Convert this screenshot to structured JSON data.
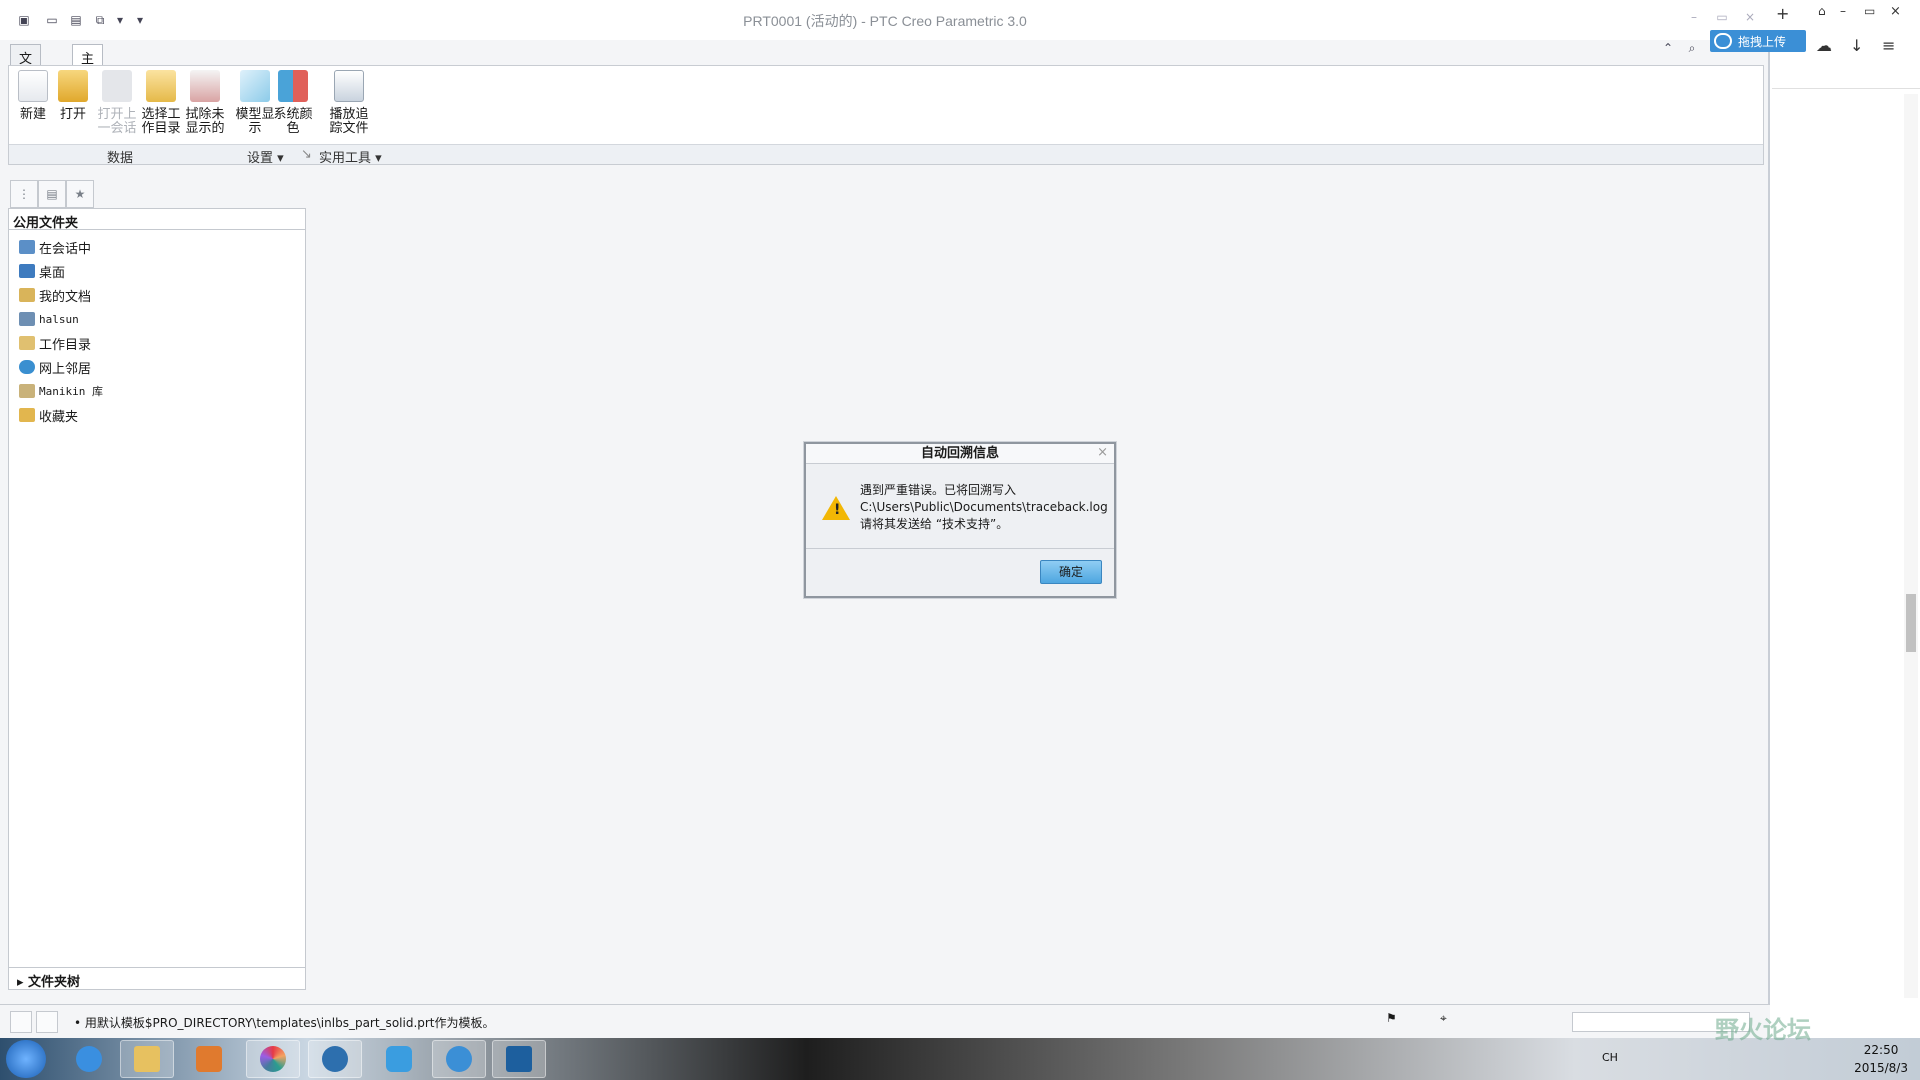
{
  "window": {
    "title": "PRT0001 (活动的) - PTC Creo Parametric 3.0"
  },
  "menu_tabs": [
    {
      "label": "文件 ▾"
    },
    {
      "label": "主页"
    }
  ],
  "ribbon": {
    "buttons": [
      {
        "label": "新建",
        "icon": "new-file-icon",
        "enabled": true
      },
      {
        "label": "打开",
        "icon": "open-folder-icon",
        "enabled": true
      },
      {
        "label": "打开上一会话",
        "icon": "open-last-session-icon",
        "enabled": false
      },
      {
        "label": "选择工作目录",
        "icon": "select-working-directory-icon",
        "enabled": true
      },
      {
        "label": "拭除未显示的",
        "icon": "erase-not-displayed-icon",
        "enabled": true
      },
      {
        "label": "模型显示",
        "icon": "model-display-icon",
        "enabled": true
      },
      {
        "label": "系统颜色",
        "icon": "system-colors-icon",
        "enabled": true
      },
      {
        "label": "播放追踪文件",
        "icon": "play-trail-file-icon",
        "enabled": true
      }
    ],
    "groups": [
      {
        "label": "数据"
      },
      {
        "label": "设置 ▾"
      },
      {
        "label": "实用工具 ▾"
      }
    ]
  },
  "navigator": {
    "header": "公用文件夹",
    "items": [
      {
        "label": "在会话中",
        "icon": "in-session-icon",
        "color": "#5b8fc7"
      },
      {
        "label": "桌面",
        "icon": "desktop-icon",
        "color": "#3e7bbf"
      },
      {
        "label": "我的文档",
        "icon": "my-documents-icon",
        "color": "#d9b45a"
      },
      {
        "label": "halsun",
        "icon": "computer-icon",
        "color": "#6e8fb3",
        "mono": true
      },
      {
        "label": "工作目录",
        "icon": "working-directory-icon",
        "color": "#e0c070"
      },
      {
        "label": "网上邻居",
        "icon": "network-icon",
        "color": "#3a8fd0"
      },
      {
        "label": "Manikin 库",
        "icon": "manikin-library-icon",
        "color": "#c9b27a",
        "mono": true
      },
      {
        "label": "收藏夹",
        "icon": "favorites-icon",
        "color": "#e2b64e"
      }
    ],
    "folder_tree": "▸ 文件夹树"
  },
  "dialog": {
    "title": "自动回溯信息",
    "close": "×",
    "line1": "遇到严重错误。已将回溯写入",
    "line2": "C:\\Users\\Public\\Documents\\traceback.log",
    "line3": "请将其发送给 “技术支持”。",
    "ok_label": "确定"
  },
  "status": {
    "message": "• 用默认模板$PRO_DIRECTORY\\templates\\inlbs_part_solid.prt作为模板。"
  },
  "browser_panel": {
    "upload_label": "拖拽上传"
  },
  "taskbar": {
    "lang": "CH",
    "time": "22:50",
    "date": "2015/8/3"
  },
  "watermark": "野火论坛"
}
